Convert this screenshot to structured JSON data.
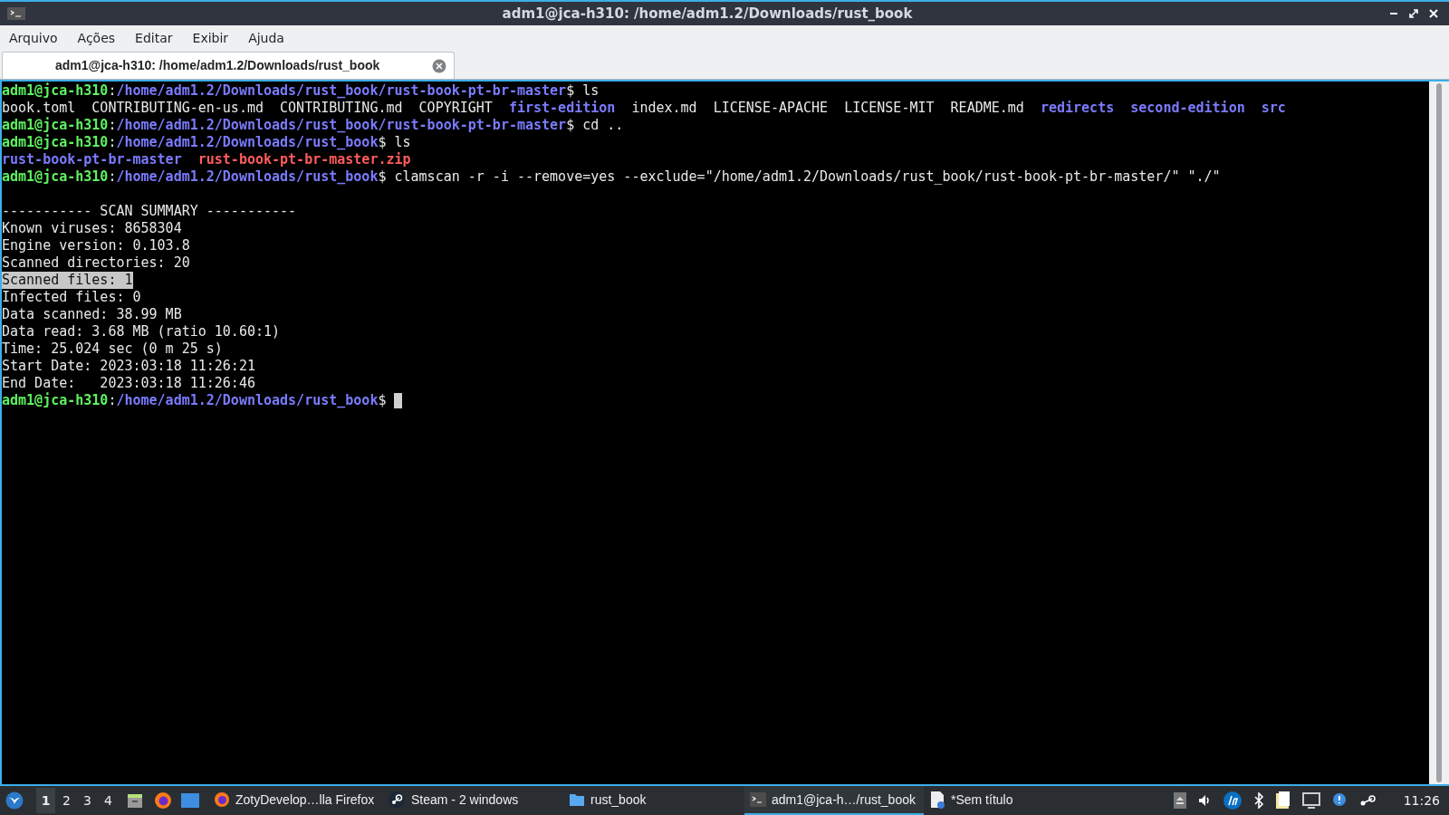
{
  "window": {
    "title": "adm1@jca-h310: /home/adm1.2/Downloads/rust_book"
  },
  "menu": [
    "Arquivo",
    "Ações",
    "Editar",
    "Exibir",
    "Ajuda"
  ],
  "tabs": [
    {
      "label": "adm1@jca-h310: /home/adm1.2/Downloads/rust_book",
      "selected": true
    }
  ],
  "terminal": {
    "lines": [
      {
        "kind": "text",
        "segments": [
          {
            "kind": "user",
            "text": "adm1@jca-h310"
          },
          {
            "kind": "plain",
            "text": ":"
          },
          {
            "kind": "path",
            "text": "/home/adm1.2/Downloads/rust_book/rust-book-pt-br-master"
          },
          {
            "kind": "plain",
            "text": "$ ls"
          }
        ]
      },
      {
        "kind": "text",
        "segments": [
          {
            "kind": "plain",
            "text": "book.toml  CONTRIBUTING-en-us.md  CONTRIBUTING.md  COPYRIGHT  "
          },
          {
            "kind": "dir",
            "text": "first-edition"
          },
          {
            "kind": "plain",
            "text": "  index.md  LICENSE-APACHE  LICENSE-MIT  README.md  "
          },
          {
            "kind": "dir",
            "text": "redirects  "
          },
          {
            "kind": "dir",
            "text": "second-edition  "
          },
          {
            "kind": "dir",
            "text": "src"
          }
        ]
      },
      {
        "kind": "text",
        "segments": [
          {
            "kind": "user",
            "text": "adm1@jca-h310"
          },
          {
            "kind": "plain",
            "text": ":"
          },
          {
            "kind": "path",
            "text": "/home/adm1.2/Downloads/rust_book/rust-book-pt-br-master"
          },
          {
            "kind": "plain",
            "text": "$ cd .."
          }
        ]
      },
      {
        "kind": "text",
        "segments": [
          {
            "kind": "user",
            "text": "adm1@jca-h310"
          },
          {
            "kind": "plain",
            "text": ":"
          },
          {
            "kind": "path",
            "text": "/home/adm1.2/Downloads/rust_book"
          },
          {
            "kind": "plain",
            "text": "$ ls"
          }
        ]
      },
      {
        "kind": "text",
        "segments": [
          {
            "kind": "dir",
            "text": "rust-book-pt-br-master  "
          },
          {
            "kind": "archive",
            "text": "rust-book-pt-br-master.zip"
          }
        ]
      },
      {
        "kind": "text",
        "segments": [
          {
            "kind": "user",
            "text": "adm1@jca-h310"
          },
          {
            "kind": "plain",
            "text": ":"
          },
          {
            "kind": "path",
            "text": "/home/adm1.2/Downloads/rust_book"
          },
          {
            "kind": "plain",
            "text": "$ clamscan -r -i --remove=yes --exclude=\"/home/adm1.2/Downloads/rust_book/rust-book-pt-br-master/\" \"./\""
          }
        ]
      },
      {
        "kind": "blank"
      },
      {
        "kind": "text",
        "segments": [
          {
            "kind": "plain",
            "text": "----------- SCAN SUMMARY -----------"
          }
        ]
      },
      {
        "kind": "text",
        "segments": [
          {
            "kind": "plain",
            "text": "Known viruses: 8658304"
          }
        ]
      },
      {
        "kind": "text",
        "segments": [
          {
            "kind": "plain",
            "text": "Engine version: 0.103.8"
          }
        ]
      },
      {
        "kind": "text",
        "segments": [
          {
            "kind": "plain",
            "text": "Scanned directories: 20"
          }
        ]
      },
      {
        "kind": "text",
        "segments": [
          {
            "kind": "highlight",
            "text": "Scanned files: 1"
          }
        ]
      },
      {
        "kind": "text",
        "segments": [
          {
            "kind": "plain",
            "text": "Infected files: 0"
          }
        ]
      },
      {
        "kind": "text",
        "segments": [
          {
            "kind": "plain",
            "text": "Data scanned: 38.99 MB"
          }
        ]
      },
      {
        "kind": "text",
        "segments": [
          {
            "kind": "plain",
            "text": "Data read: 3.68 MB (ratio 10.60:1)"
          }
        ]
      },
      {
        "kind": "text",
        "segments": [
          {
            "kind": "plain",
            "text": "Time: 25.024 sec (0 m 25 s)"
          }
        ]
      },
      {
        "kind": "text",
        "segments": [
          {
            "kind": "plain",
            "text": "Start Date: 2023:03:18 11:26:21"
          }
        ]
      },
      {
        "kind": "text",
        "segments": [
          {
            "kind": "plain",
            "text": "End Date:   2023:03:18 11:26:46"
          }
        ]
      },
      {
        "kind": "text",
        "cursor": true,
        "segments": [
          {
            "kind": "user",
            "text": "adm1@jca-h310"
          },
          {
            "kind": "plain",
            "text": ":"
          },
          {
            "kind": "path",
            "text": "/home/adm1.2/Downloads/rust_book"
          },
          {
            "kind": "plain",
            "text": "$ "
          }
        ]
      }
    ]
  },
  "taskbar": {
    "workspaces": [
      {
        "label": "1",
        "selected": true
      },
      {
        "label": "2",
        "selected": false
      },
      {
        "label": "3",
        "selected": false
      },
      {
        "label": "4",
        "selected": false
      }
    ],
    "tasks": [
      {
        "kind": "firefox",
        "label": "ZotyDevelop…lla Firefox",
        "selected": false
      },
      {
        "kind": "steam",
        "label": "Steam - 2 windows",
        "selected": false
      },
      {
        "kind": "folder",
        "label": "rust_book",
        "selected": false
      },
      {
        "kind": "terminal",
        "label": "adm1@jca-h…/rust_book",
        "selected": true
      },
      {
        "kind": "editor",
        "label": "*Sem título",
        "selected": false
      }
    ],
    "clock": "11:26"
  }
}
